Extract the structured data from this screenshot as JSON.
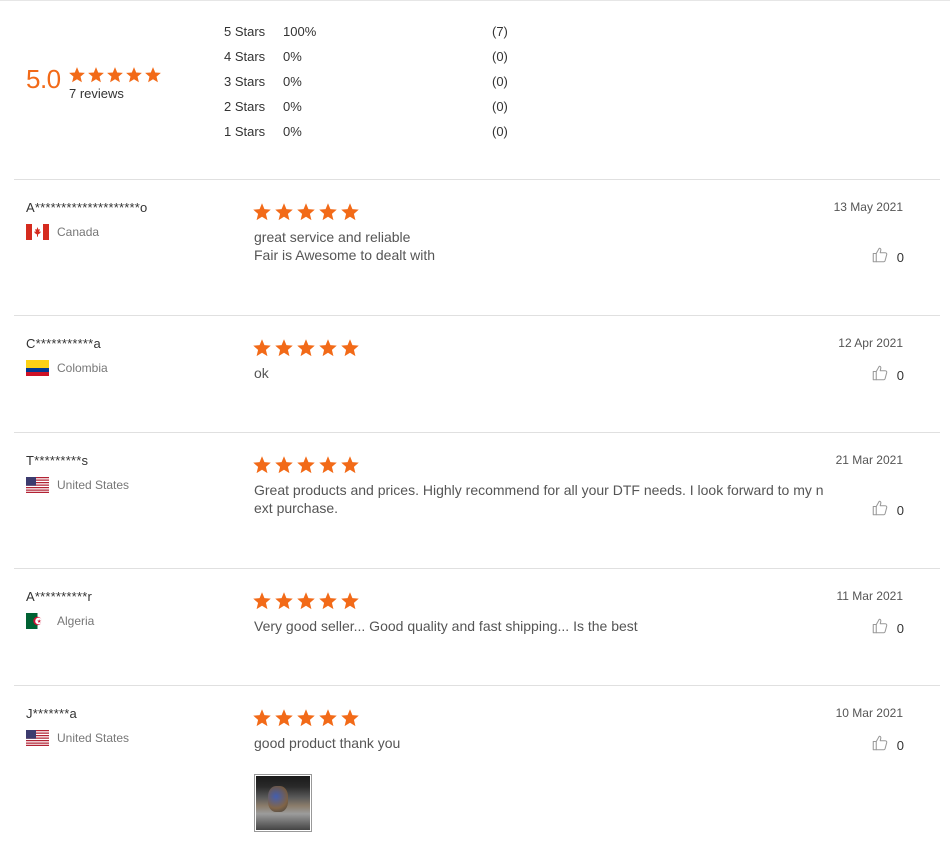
{
  "summary": {
    "average": "5.0",
    "reviews_label": "7 reviews",
    "distribution": [
      {
        "label": "5  Stars",
        "percent": "100%",
        "count": "(7)"
      },
      {
        "label": "4  Stars",
        "percent": "0%",
        "count": "(0)"
      },
      {
        "label": "3  Stars",
        "percent": "0%",
        "count": "(0)"
      },
      {
        "label": "2  Stars",
        "percent": "0%",
        "count": "(0)"
      },
      {
        "label": "1  Stars",
        "percent": "0%",
        "count": "(0)"
      }
    ]
  },
  "colors": {
    "star": "#f26a18",
    "accent": "#f26a18"
  },
  "reviews": [
    {
      "name": "A********************o",
      "country": "Canada",
      "flag_icon": "canada-flag-icon",
      "rating": 5,
      "text_lines": [
        "great service and reliable",
        "Fair is Awesome to dealt with"
      ],
      "date": "13 May 2021",
      "likes": "0"
    },
    {
      "name": "C***********a",
      "country": "Colombia",
      "flag_icon": "colombia-flag-icon",
      "rating": 5,
      "text_lines": [
        "ok"
      ],
      "date": "12 Apr 2021",
      "likes": "0"
    },
    {
      "name": "T*********s",
      "country": "United States",
      "flag_icon": "usa-flag-icon",
      "rating": 5,
      "text_lines": [
        "Great products and prices. Highly recommend for all your DTF needs. I look forward to my n",
        "ext purchase."
      ],
      "date": "21 Mar 2021",
      "likes": "0"
    },
    {
      "name": "A**********r",
      "country": "Algeria",
      "flag_icon": "algeria-flag-icon",
      "rating": 5,
      "text_lines": [
        "Very good seller... Good quality and fast shipping... Is the best"
      ],
      "date": "11 Mar 2021",
      "likes": "0"
    },
    {
      "name": "J*******a",
      "country": "United States",
      "flag_icon": "usa-flag-icon",
      "rating": 5,
      "text_lines": [
        "good product thank you"
      ],
      "date": "10 Mar 2021",
      "likes": "0",
      "has_photo": true
    }
  ]
}
